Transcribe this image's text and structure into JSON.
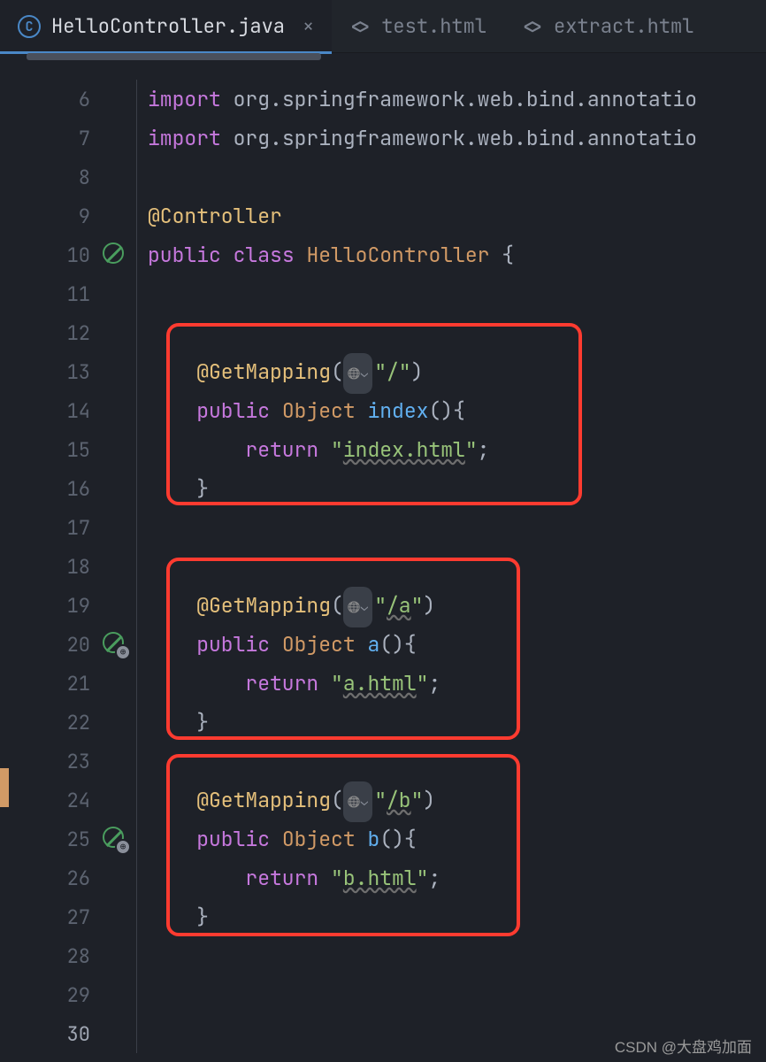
{
  "tabs": [
    {
      "label": "HelloController.java",
      "active": true,
      "icon": "class"
    },
    {
      "label": "test.html",
      "active": false,
      "icon": "html"
    },
    {
      "label": "extract.html",
      "active": false,
      "icon": "html"
    }
  ],
  "gutter_start": 6,
  "gutter_end": 30,
  "current_line": 30,
  "code": {
    "l6": "import org.springframework.web.bind.annotatio",
    "l7": "import org.springframework.web.bind.annotatio",
    "l9_anno": "@Controller",
    "l10_kw1": "public",
    "l10_kw2": "class",
    "l10_type": "HelloController",
    "l10_brace": " {",
    "l13_anno": "@GetMapping",
    "l13_str": "\"/\"",
    "l14_kw": "public",
    "l14_type": "Object",
    "l14_fn": "index",
    "l14_after": "(){",
    "l15_kw": "return",
    "l15_str_q": "\"",
    "l15_str": "index.html",
    "l15_semi": ";",
    "l16_brace": "}",
    "l19_anno": "@GetMapping",
    "l19_str_q": "\"",
    "l19_str": "/a",
    "l20_kw": "public",
    "l20_type": "Object",
    "l20_fn": "a",
    "l20_after": "(){",
    "l21_kw": "return",
    "l21_str_q": "\"",
    "l21_str": "a.html",
    "l21_semi": ";",
    "l22_brace": "}",
    "l24_anno": "@GetMapping",
    "l24_str_q": "\"",
    "l24_str": "/b",
    "l25_kw": "public",
    "l25_type": "Object",
    "l25_fn": "b",
    "l25_after": "(){",
    "l26_kw": "return",
    "l26_str_q": "\"",
    "l26_str": "b.html",
    "l26_semi": ";",
    "l27_brace": "}"
  },
  "watermark": "CSDN @大盘鸡加面"
}
